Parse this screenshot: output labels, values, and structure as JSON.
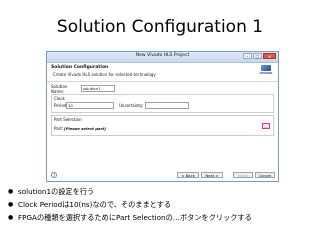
{
  "slide": {
    "title": "Solution Configuration 1",
    "bullets": [
      "solution1の設定を行う",
      "Clock Periodは10(ns)なので、そのままとする",
      "FPGAの種類を選択するためにPart Selectionの…ボタンをクリックする"
    ]
  },
  "dialog": {
    "window_title": "New Vivado HLS Project",
    "header_title": "Solution Configuration",
    "header_subtitle": "Create Vivado HLS solution for selected technology",
    "logo_text": "VIVADO",
    "solution_name_label": "Solution Name:",
    "solution_name_value": "solution1",
    "clock_group_label": "Clock",
    "period_label": "Period:",
    "period_value": "10",
    "uncertainty_label": "Uncertainty:",
    "uncertainty_value": "",
    "part_group_label": "Part Selection",
    "part_label": "Part:",
    "part_value": "[Please select part]",
    "browse_label": "...",
    "help_label": "?",
    "back_label": "< Back",
    "next_label": "Next >",
    "finish_label": "Finish",
    "cancel_label": "Cancel",
    "minimize_label": "–",
    "maximize_label": "□",
    "close_label": "✕"
  }
}
